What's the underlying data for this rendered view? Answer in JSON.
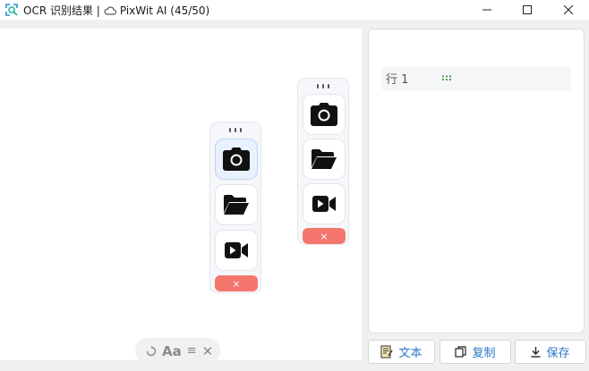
{
  "window": {
    "title_main": "OCR 识别结果 |",
    "title_app": "PixWit AI (45/50)",
    "controls": {
      "minimize": "minimize-icon",
      "maximize": "maximize-icon",
      "close": "close-icon"
    }
  },
  "panel_a": {
    "buttons": [
      {
        "icon": "camera-icon",
        "active": true
      },
      {
        "icon": "folder-open-icon",
        "active": false
      },
      {
        "icon": "video-icon",
        "active": false
      }
    ],
    "close_label": "×"
  },
  "panel_b": {
    "buttons": [
      {
        "icon": "camera-icon",
        "active": false
      },
      {
        "icon": "folder-open-icon",
        "active": false
      },
      {
        "icon": "video-icon",
        "active": false
      }
    ],
    "close_label": "×"
  },
  "mini_toolbar": {
    "font_label": "Aa",
    "menu_glyph": "≡",
    "close_glyph": "✕"
  },
  "results": {
    "rows": [
      {
        "label": "行 1",
        "grip": ":::"
      }
    ]
  },
  "actions": {
    "text_label": "文本",
    "copy_label": "复制",
    "save_label": "保存"
  },
  "colors": {
    "accent": "#2b78c9",
    "close_pill": "#f4766d",
    "active_button": "#e9f1ff"
  }
}
